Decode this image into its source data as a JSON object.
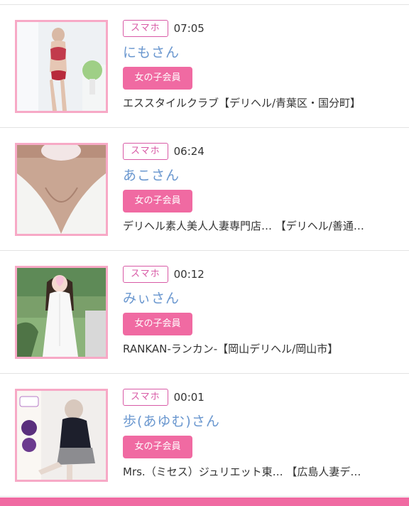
{
  "feed": {
    "items": [
      {
        "device": "スマホ",
        "time": "07:05",
        "name": "にもさん",
        "badge": "女の子会員",
        "shop": "エススタイルクラブ【デリヘル/青葉区・国分町】"
      },
      {
        "device": "スマホ",
        "time": "06:24",
        "name": "あこさん",
        "badge": "女の子会員",
        "shop": "デリヘル素人美人人妻専門店… 【デリヘル/善通…"
      },
      {
        "device": "スマホ",
        "time": "00:12",
        "name": "みぃさん",
        "badge": "女の子会員",
        "shop": "RANKAN-ランカン-【岡山デリヘル/岡山市】"
      },
      {
        "device": "スマホ",
        "time": "00:01",
        "name": "歩(あゆむ)さん",
        "badge": "女の子会員",
        "shop": "Mrs.（ミセス）ジュリエット東… 【広島人妻デ…"
      }
    ]
  },
  "colors": {
    "accent_pink": "#f06aa2",
    "thumb_border": "#f7a9c6",
    "device_badge": "#d85aa6",
    "name_link": "#6a97cf"
  }
}
